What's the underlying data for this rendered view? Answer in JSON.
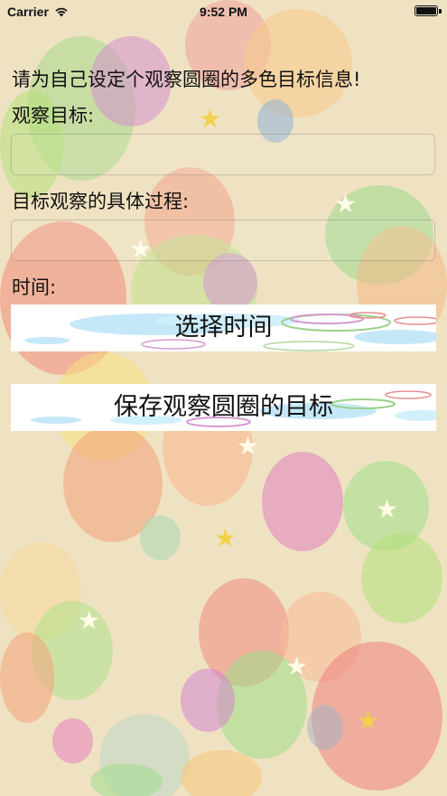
{
  "status_bar": {
    "carrier": "Carrier",
    "time": "9:52 PM"
  },
  "form": {
    "heading": "请为自己设定个观察圆圈的多色目标信息!",
    "target_label": "观察目标:",
    "target_value": "",
    "process_label": "目标观察的具体过程:",
    "process_value": "",
    "time_label": "时间:",
    "select_time_button": "选择时间",
    "save_button": "保存观察圆圈的目标"
  },
  "colors": {
    "background": "#efe2c2",
    "button_background": "#ffffff"
  },
  "icons": {
    "wifi": "wifi-icon",
    "battery": "battery-icon",
    "star": "star-icon"
  }
}
